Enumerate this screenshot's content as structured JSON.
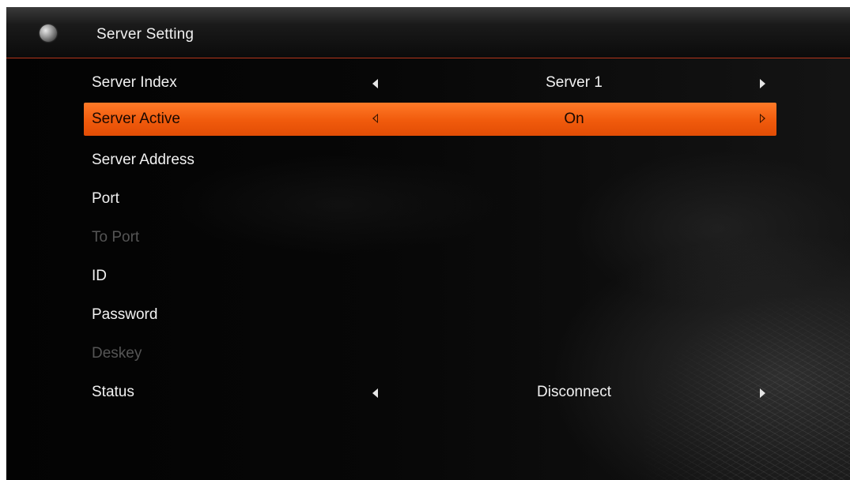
{
  "header": {
    "title": "Server Setting",
    "icon": "globe-icon"
  },
  "colors": {
    "accent": "#f05a0c",
    "header_divider": "#b5361c",
    "text": "#f2f2f2",
    "disabled_text": "#555555"
  },
  "settings": {
    "server_index": {
      "label": "Server Index",
      "value": "Server 1"
    },
    "server_active": {
      "label": "Server Active",
      "value": "On",
      "selected": true
    },
    "server_address": {
      "label": "Server Address",
      "value": ""
    },
    "port": {
      "label": "Port",
      "value": ""
    },
    "to_port": {
      "label": "To Port",
      "value": "",
      "disabled": true
    },
    "id": {
      "label": "ID",
      "value": ""
    },
    "password": {
      "label": "Password",
      "value": ""
    },
    "deskey": {
      "label": "Deskey",
      "value": "",
      "disabled": true
    },
    "status": {
      "label": "Status",
      "value": "Disconnect"
    }
  },
  "icons": {
    "prev": "arrow-left-icon",
    "next": "arrow-right-icon"
  }
}
